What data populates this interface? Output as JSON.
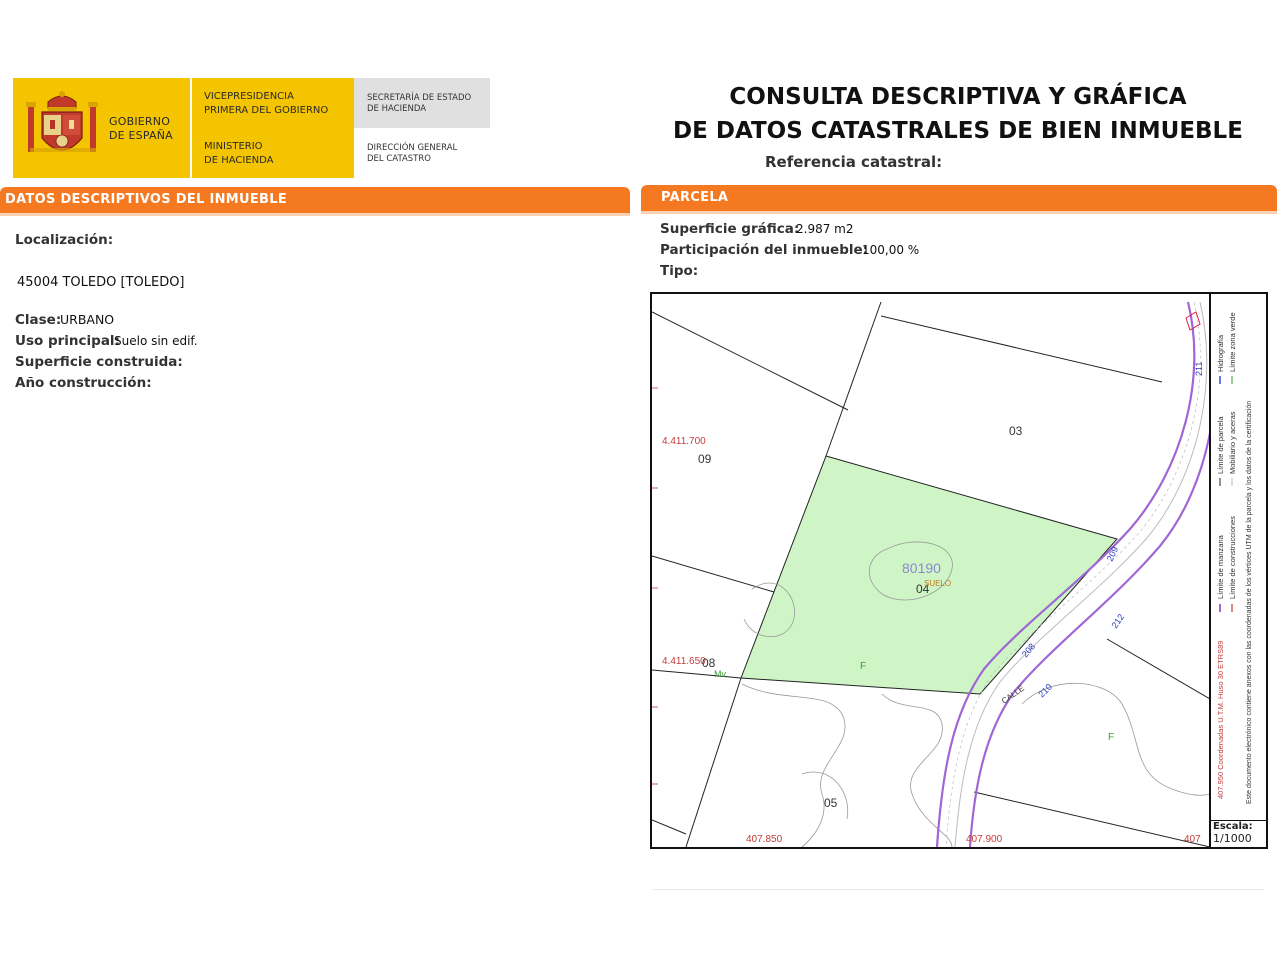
{
  "header": {
    "gobierno": "GOBIERNO\nDE ESPAÑA",
    "vicepresidencia": "VICEPRESIDENCIA\nPRIMERA DEL GOBIERNO",
    "ministerio": "MINISTERIO\nDE HACIENDA",
    "secretaria": "SECRETARÍA DE ESTADO\nDE HACIENDA",
    "direccion": "DIRECCIÓN GENERAL\nDEL CATASTRO"
  },
  "title": "CONSULTA DESCRIPTIVA Y GRÁFICA\nDE DATOS CATASTRALES DE BIEN INMUEBLE",
  "referencia_label": "Referencia catastral:",
  "datos": {
    "section": "DATOS DESCRIPTIVOS DEL INMUEBLE",
    "localizacion_label": "Localización:",
    "localizacion_value": "45004 TOLEDO [TOLEDO]",
    "clase_label": "Clase:",
    "clase_value": "URBANO",
    "uso_label": "Uso principal:",
    "uso_value": "Suelo sin edif.",
    "superficie_label": "Superficie construida:",
    "anio_label": "Año construcción:"
  },
  "parcela": {
    "section": "PARCELA",
    "superficie_label": "Superficie gráfica:",
    "superficie_value": "2.987 m2",
    "participacion_label": "Participación del inmueble:",
    "participacion_value": "100,00 %",
    "tipo_label": "Tipo:"
  },
  "map": {
    "coord_y_top": "4.411.700",
    "coord_y_bottom": "4.411.650",
    "coord_x_left": "407.850",
    "coord_x_mid": "407.900",
    "coord_x_right": "407",
    "plot_03": "03",
    "plot_09": "09",
    "plot_04": "04",
    "plot_08": "08",
    "plot_05": "05",
    "parcel_code": "80190",
    "suelo": "SUELO",
    "street": "CALLE",
    "n211": "211",
    "n209": "209",
    "n212": "212",
    "n208": "208",
    "n210": "210",
    "mark_f1": "F",
    "mark_f2": "F",
    "mark_mv": "Mv",
    "parcel_fill": "#cff5c7",
    "street_color": "#a066d6",
    "coord_color": "#c43c3c"
  },
  "legend": {
    "limite_manzana": "Límite de manzana",
    "limite_construcciones": "Límite de construcciones",
    "limite_parcela": "Límite de parcela",
    "mobiliario": "Mobiliario y aceras",
    "hidrografia": "Hidrografía",
    "zona_verde": "Límite zona verde",
    "coordenadas": "407.950 Coordenadas U.T.M. Huso 30 ETRS89",
    "documento": "Este documento electrónico contiene anexos con las coordenadas de los vértices UTM de la parcela y los datos de la certificación",
    "escala_label": "Escala:",
    "escala_value": "1/1000"
  }
}
